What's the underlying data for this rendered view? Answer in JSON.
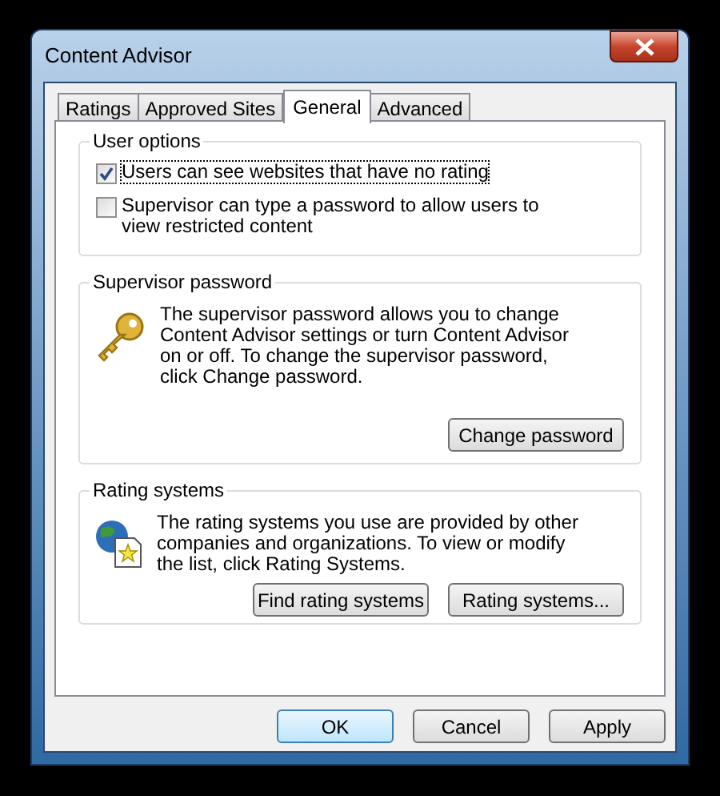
{
  "window": {
    "title": "Content Advisor"
  },
  "tabs": [
    {
      "label": "Ratings",
      "selected": false
    },
    {
      "label": "Approved Sites",
      "selected": false
    },
    {
      "label": "General",
      "selected": true
    },
    {
      "label": "Advanced",
      "selected": false
    }
  ],
  "user_options": {
    "title": "User options",
    "options": [
      {
        "label": "Users can see websites that have no rating",
        "checked": true,
        "focused": true
      },
      {
        "label": "Supervisor can type a password to allow users to view restricted content",
        "checked": false,
        "focused": false
      }
    ]
  },
  "supervisor_password": {
    "title": "Supervisor password",
    "text": "The supervisor password allows you to change Content Advisor settings or turn Content Advisor on or off. To change the supervisor password, click Change password.",
    "buttons": [
      "Change password"
    ]
  },
  "rating_systems": {
    "title": "Rating systems",
    "text": "The rating systems you use are provided by other companies and organizations. To view or modify the list, click Rating Systems.",
    "buttons": [
      "Find rating systems",
      "Rating systems..."
    ]
  },
  "buttons": [
    {
      "label": "OK",
      "default": true
    },
    {
      "label": "Cancel",
      "default": false
    },
    {
      "label": "Apply",
      "default": false
    }
  ]
}
